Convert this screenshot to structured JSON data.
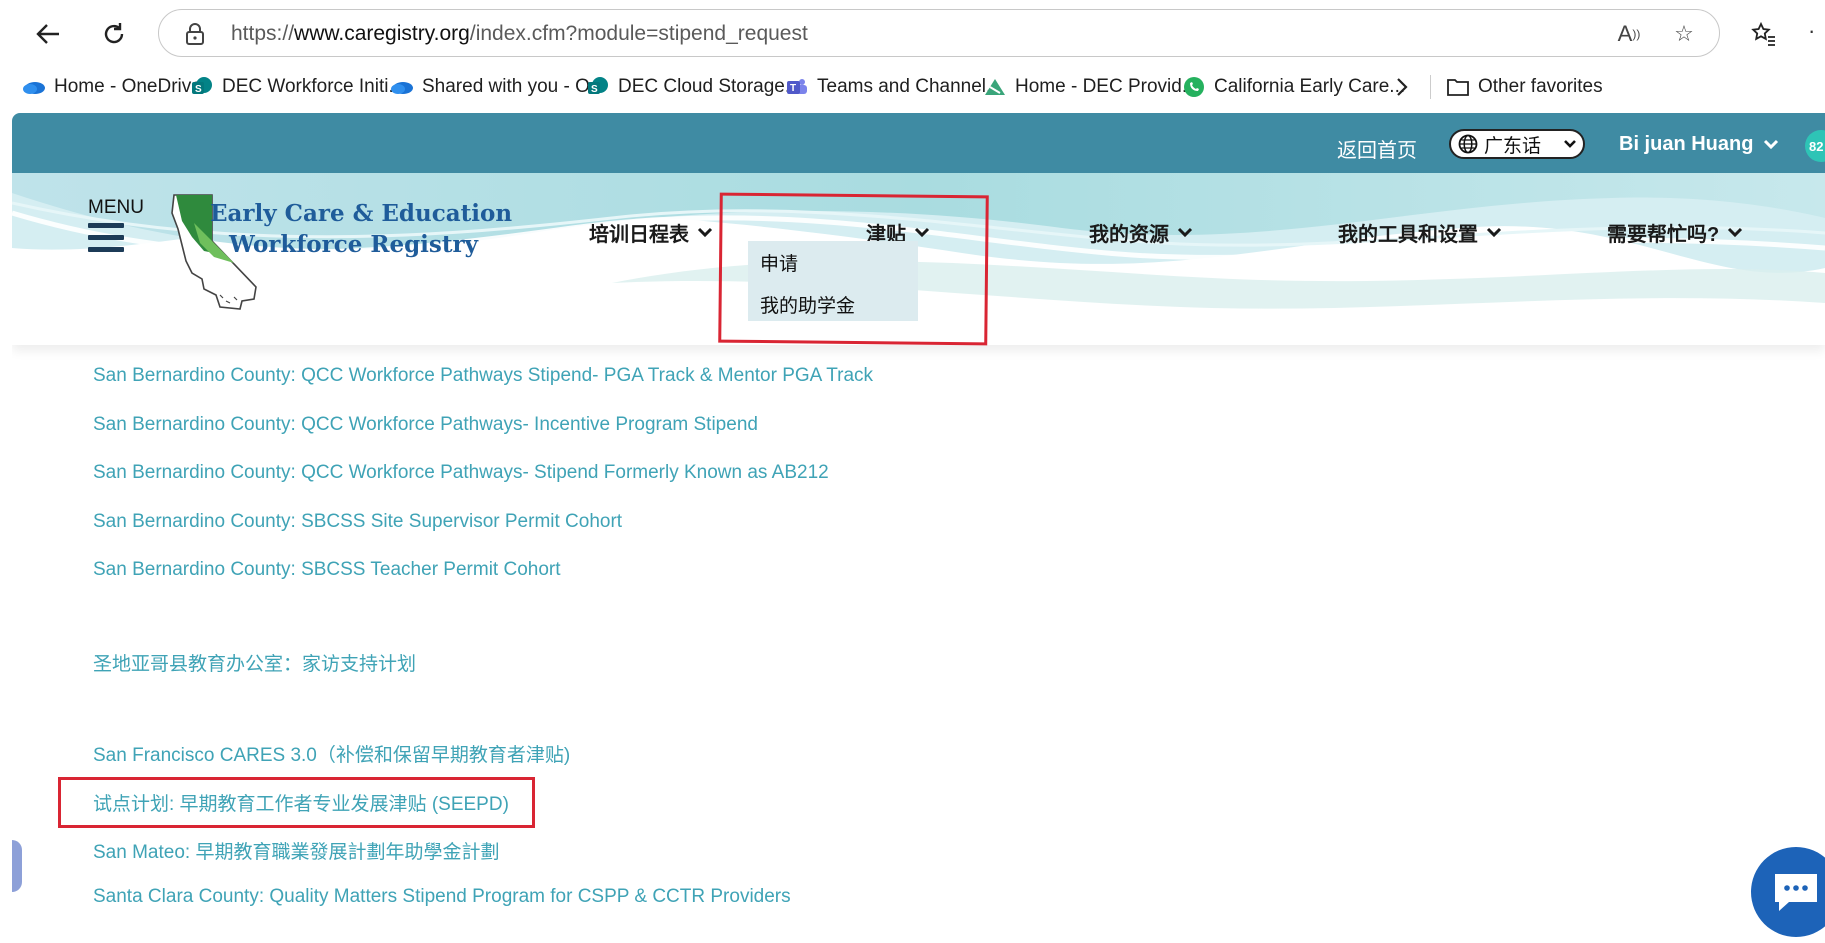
{
  "browser": {
    "url_prefix": "https://",
    "url_domain": "www.caregistry.org",
    "url_path": "/index.cfm?module=stipend_request",
    "bookmarks": [
      {
        "label": "Home - OneDrive",
        "icon": "onedrive-icon"
      },
      {
        "label": "DEC Workforce Initi...",
        "icon": "sharepoint-icon"
      },
      {
        "label": "Shared with you - O...",
        "icon": "onedrive-icon"
      },
      {
        "label": "DEC Cloud Storage...",
        "icon": "sharepoint-icon"
      },
      {
        "label": "Teams and Channel...",
        "icon": "teams-icon"
      },
      {
        "label": "Home - DEC Provid...",
        "icon": "dec-icon"
      },
      {
        "label": "California Early Care...",
        "icon": "whatsapp-icon"
      }
    ],
    "other_favorites": "Other favorites"
  },
  "topbar": {
    "home_link": "返回首页",
    "language": "广东话",
    "user_name": "Bi juan Huang",
    "badge": "82"
  },
  "header": {
    "menu_label": "MENU",
    "logo_line1": "Early Care & Education",
    "logo_line2": "Workforce Registry",
    "nav": [
      {
        "label": "培训日程表"
      },
      {
        "label": "津贴"
      },
      {
        "label": "我的资源"
      },
      {
        "label": "我的工具和设置"
      },
      {
        "label": "需要帮忙吗?"
      }
    ],
    "stipend_dropdown": [
      "申请",
      "我的助学金"
    ]
  },
  "content": {
    "links": [
      "San Bernardino County: QCC Workforce Pathways Stipend- PGA Track & Mentor PGA Track",
      "San Bernardino County: QCC Workforce Pathways- Incentive Program Stipend",
      "San Bernardino County: QCC Workforce Pathways- Stipend Formerly Known as AB212",
      "San Bernardino County: SBCSS Site Supervisor Permit Cohort",
      "San Bernardino County: SBCSS Teacher Permit Cohort",
      "圣地亚哥县教育办公室：家访支持计划",
      "San Francisco CARES 3.0（补偿和保留早期教育者津贴)",
      "试点计划: 早期教育工作者专业发展津贴 (SEEPD)",
      "San Mateo: 早期教育職業發展計劃年助學金計劃",
      "Santa Clara County: Quality Matters Stipend Program for CSPP & CCTR Providers"
    ]
  },
  "colors": {
    "topbar": "#3f8ba3",
    "link": "#3fa3b6",
    "logo_text": "#1f5c9a",
    "highlight": "#d92533",
    "dropdown_bg": "#dcebef"
  }
}
